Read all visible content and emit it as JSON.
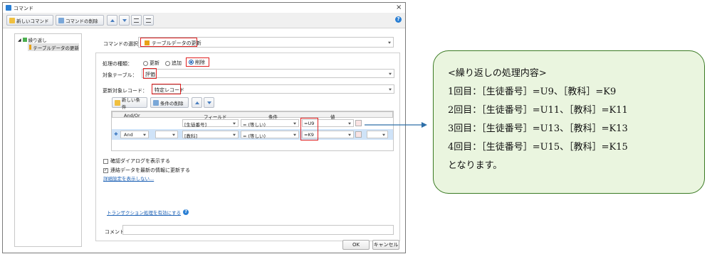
{
  "window": {
    "title": "コマンド"
  },
  "toolbar": {
    "new_command": "新しいコマンド",
    "delete_command": "コマンドの削除"
  },
  "tree": {
    "root": "繰り返し",
    "child": "テーブルデータの更新"
  },
  "command": {
    "label": "コマンドの選択：",
    "value": "テーブルデータの更新"
  },
  "process": {
    "label": "処理の種類：",
    "options": [
      "更新",
      "追加",
      "削除"
    ],
    "selected": "削除"
  },
  "target_table": {
    "label": "対象テーブル：",
    "value": "評価"
  },
  "update_target": {
    "label": "更新対象レコード：",
    "value": "特定レコード"
  },
  "conditions": {
    "new_label": "新しい条件",
    "delete_label": "条件の削除",
    "headers": [
      "And/Or",
      "フィールド",
      "条件",
      "値"
    ],
    "rows": [
      {
        "andor": "",
        "field": "[生徒番号]",
        "cond": "= (等しい)",
        "value": "=U9"
      },
      {
        "andor": "And",
        "field": "[教科]",
        "cond": "= (等しい)",
        "value": "=K9"
      }
    ]
  },
  "confirm_dialog": {
    "label": "確認ダイアログを表示する",
    "checked": false
  },
  "refresh_data": {
    "label": "連結データを最新の情報に更新する",
    "checked": true
  },
  "advanced_link": "詳細設定を表示しない...",
  "transaction_link": "トランザクション処理を有効にする",
  "comment": {
    "label": "コメント",
    "value": ""
  },
  "buttons": {
    "ok": "OK",
    "cancel": "キャンセル"
  },
  "note": {
    "heading": "<繰り返しの処理内容>",
    "lines": [
      "1回目：［生徒番号］=U9、［教科］=K9",
      "2回目：［生徒番号］=U11、［教科］=K11",
      "3回目：［生徒番号］=U13、［教科］=K13",
      "4回目：［生徒番号］=U15、［教科］=K15"
    ],
    "footer": "となります。"
  },
  "colors": {
    "highlight": "#e02020",
    "bubble_fill": "#eaf5df",
    "bubble_border": "#3a7a22",
    "link": "#1a5fb4"
  }
}
